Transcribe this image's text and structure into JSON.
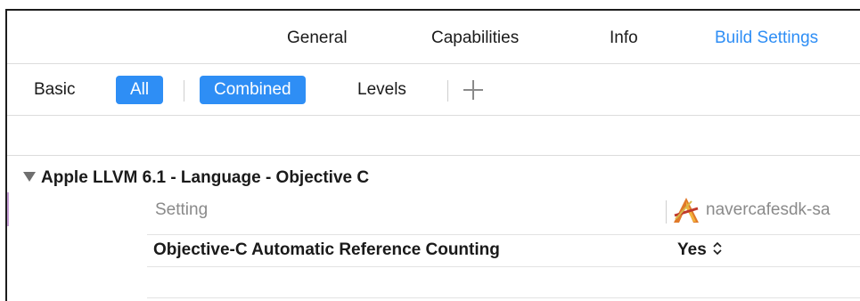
{
  "tabs": [
    {
      "label": "General"
    },
    {
      "label": "Capabilities"
    },
    {
      "label": "Info"
    },
    {
      "label": "Build Settings",
      "selected": true
    }
  ],
  "filter": {
    "basic": "Basic",
    "all": "All",
    "combined": "Combined",
    "levels": "Levels",
    "add_icon": "plus-icon"
  },
  "section": {
    "title": "Apple LLVM 6.1 - Language - Objective C",
    "disclosure_icon": "disclosure-triangle-icon"
  },
  "table": {
    "column_setting": "Setting",
    "target_name": "navercafesdk-sa",
    "target_icon": "app-target-icon",
    "rows": [
      {
        "name": "Objective-C Automatic Reference Counting",
        "value": "Yes"
      }
    ]
  },
  "colors": {
    "accent": "#2e8ef5",
    "muted_text": "#8a8a8a"
  }
}
